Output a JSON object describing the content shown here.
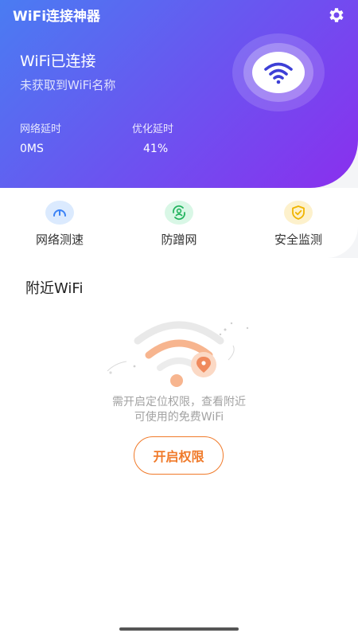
{
  "app_title": "WiFi连接神器",
  "status": {
    "title": "WiFi已连接",
    "subtitle": "未获取到WiFi名称"
  },
  "stats": [
    {
      "label": "网络延时",
      "value": "0MS"
    },
    {
      "label": "优化延时",
      "value": "41%"
    }
  ],
  "features": [
    {
      "label": "网络测速",
      "icon": "speedometer-icon",
      "bg": "#dbeafe",
      "color": "#3b82f6"
    },
    {
      "label": "防蹭网",
      "icon": "shield-user-icon",
      "bg": "#d9f7e6",
      "color": "#22b35e"
    },
    {
      "label": "安全监测",
      "icon": "shield-check-icon",
      "bg": "#fdf1cc",
      "color": "#f0b400"
    }
  ],
  "nearby": {
    "title": "附近WiFi",
    "hint_line1": "需开启定位权限，查看附近",
    "hint_line2": "可使用的免费WiFi",
    "button_label": "开启权限"
  },
  "colors": {
    "accent": "#f07a2a",
    "gradient_start": "#4a7cf2",
    "gradient_end": "#8a2fee"
  }
}
